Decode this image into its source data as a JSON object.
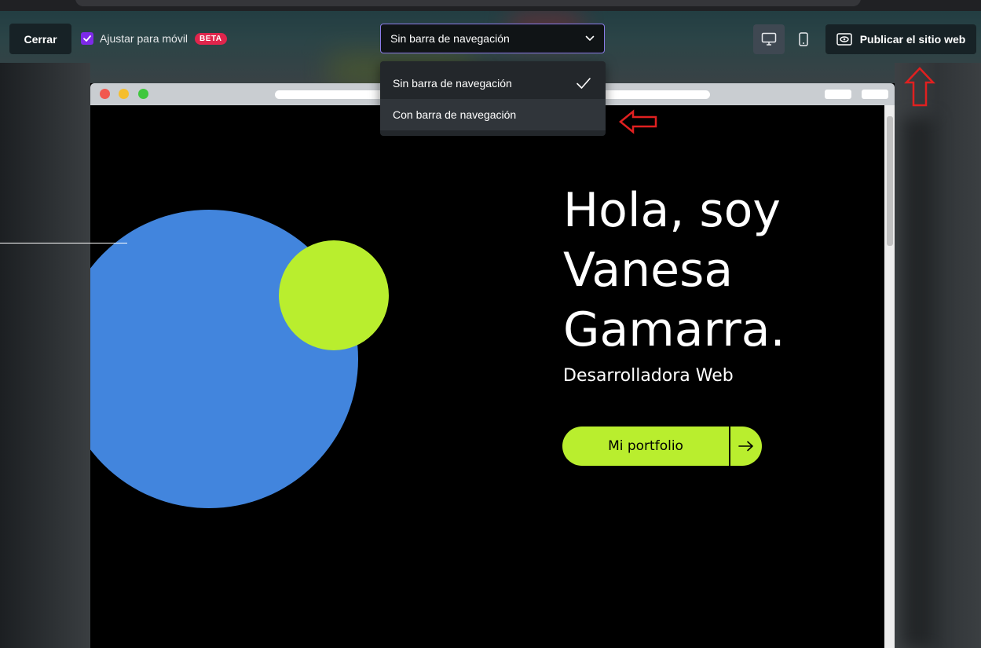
{
  "toolbar": {
    "close_label": "Cerrar",
    "mobile_adjust_label": "Ajustar para móvil",
    "mobile_adjust_checked": true,
    "beta_badge": "BETA",
    "nav_select_value": "Sin barra de navegación",
    "publish_label": "Publicar el sitio web",
    "desktop_view_icon": "monitor-icon",
    "mobile_view_icon": "smartphone-icon"
  },
  "nav_menu": {
    "options": [
      {
        "label": "Sin barra de navegación",
        "selected": true
      },
      {
        "label": "Con barra de navegación",
        "selected": false
      }
    ]
  },
  "preview": {
    "hero_title": "Hola, soy Vanesa Gamarra.",
    "hero_subtitle": "Desarrolladora Web",
    "cta_label": "Mi portfolio"
  },
  "colors": {
    "accent_purple": "#7d2ae8",
    "beta_red": "#e0254c",
    "lime": "#b9ee2e",
    "blue": "#4285dd",
    "annotation_red": "#e02020"
  }
}
